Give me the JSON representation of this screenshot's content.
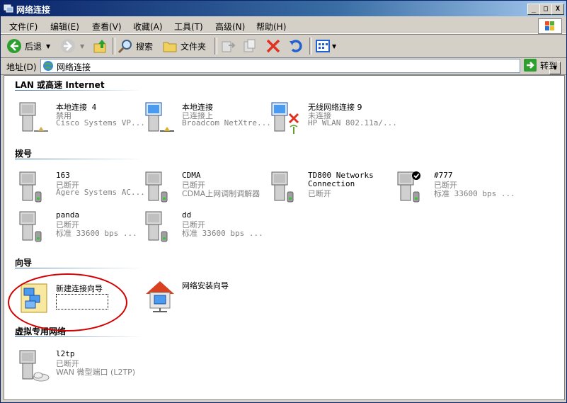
{
  "window": {
    "title": "网络连接",
    "controls": [
      "_",
      "□",
      "X"
    ]
  },
  "menu": [
    "文件(F)",
    "编辑(E)",
    "查看(V)",
    "收藏(A)",
    "工具(T)",
    "高级(N)",
    "帮助(H)"
  ],
  "toolbar": {
    "back_label": "后退",
    "search_label": "搜索",
    "folders_label": "文件夹"
  },
  "address": {
    "label": "地址(D)",
    "value": "网络连接",
    "go_label": "转到"
  },
  "groups": {
    "lan": "LAN 或高速 Internet",
    "dialup": "拨号",
    "wizard": "向导",
    "vpn": "虚拟专用网络"
  },
  "items": {
    "local4": {
      "name": "本地连接 4",
      "status": "禁用",
      "device": "Cisco Systems VP..."
    },
    "local": {
      "name": "本地连接",
      "status": "已连接上",
      "device": "Broadcom NetXtre..."
    },
    "wireless9": {
      "name": "无线网络连接 9",
      "status": "未连接",
      "device": "HP WLAN 802.11a/..."
    },
    "c163": {
      "name": "163",
      "status": "已断开",
      "device": "Agere Systems AC..."
    },
    "cdma": {
      "name": "CDMA",
      "status": "已断开",
      "device": "CDMA上网调制调解器"
    },
    "td800": {
      "name": "TD800 Networks",
      "name2": "Connection",
      "status": "已断开"
    },
    "c777": {
      "name": "#777",
      "status": "已断开",
      "device": "标准 33600 bps ..."
    },
    "panda": {
      "name": "panda",
      "status": "已断开",
      "device": "标准 33600 bps ..."
    },
    "dd": {
      "name": "dd",
      "status": "已断开",
      "device": "标准 33600 bps ..."
    },
    "newconn": {
      "name": "新建连接向导"
    },
    "netsetup": {
      "name": "网络安装向导"
    },
    "l2tp": {
      "name": "l2tp",
      "status": "已断开",
      "device": "WAN 微型端口 (L2TP)"
    }
  },
  "colors": {
    "titlebar": "#0a246a",
    "annotation_circle": "#d40000",
    "back_green": "#2e9e2e",
    "delete_red": "#e03020"
  }
}
